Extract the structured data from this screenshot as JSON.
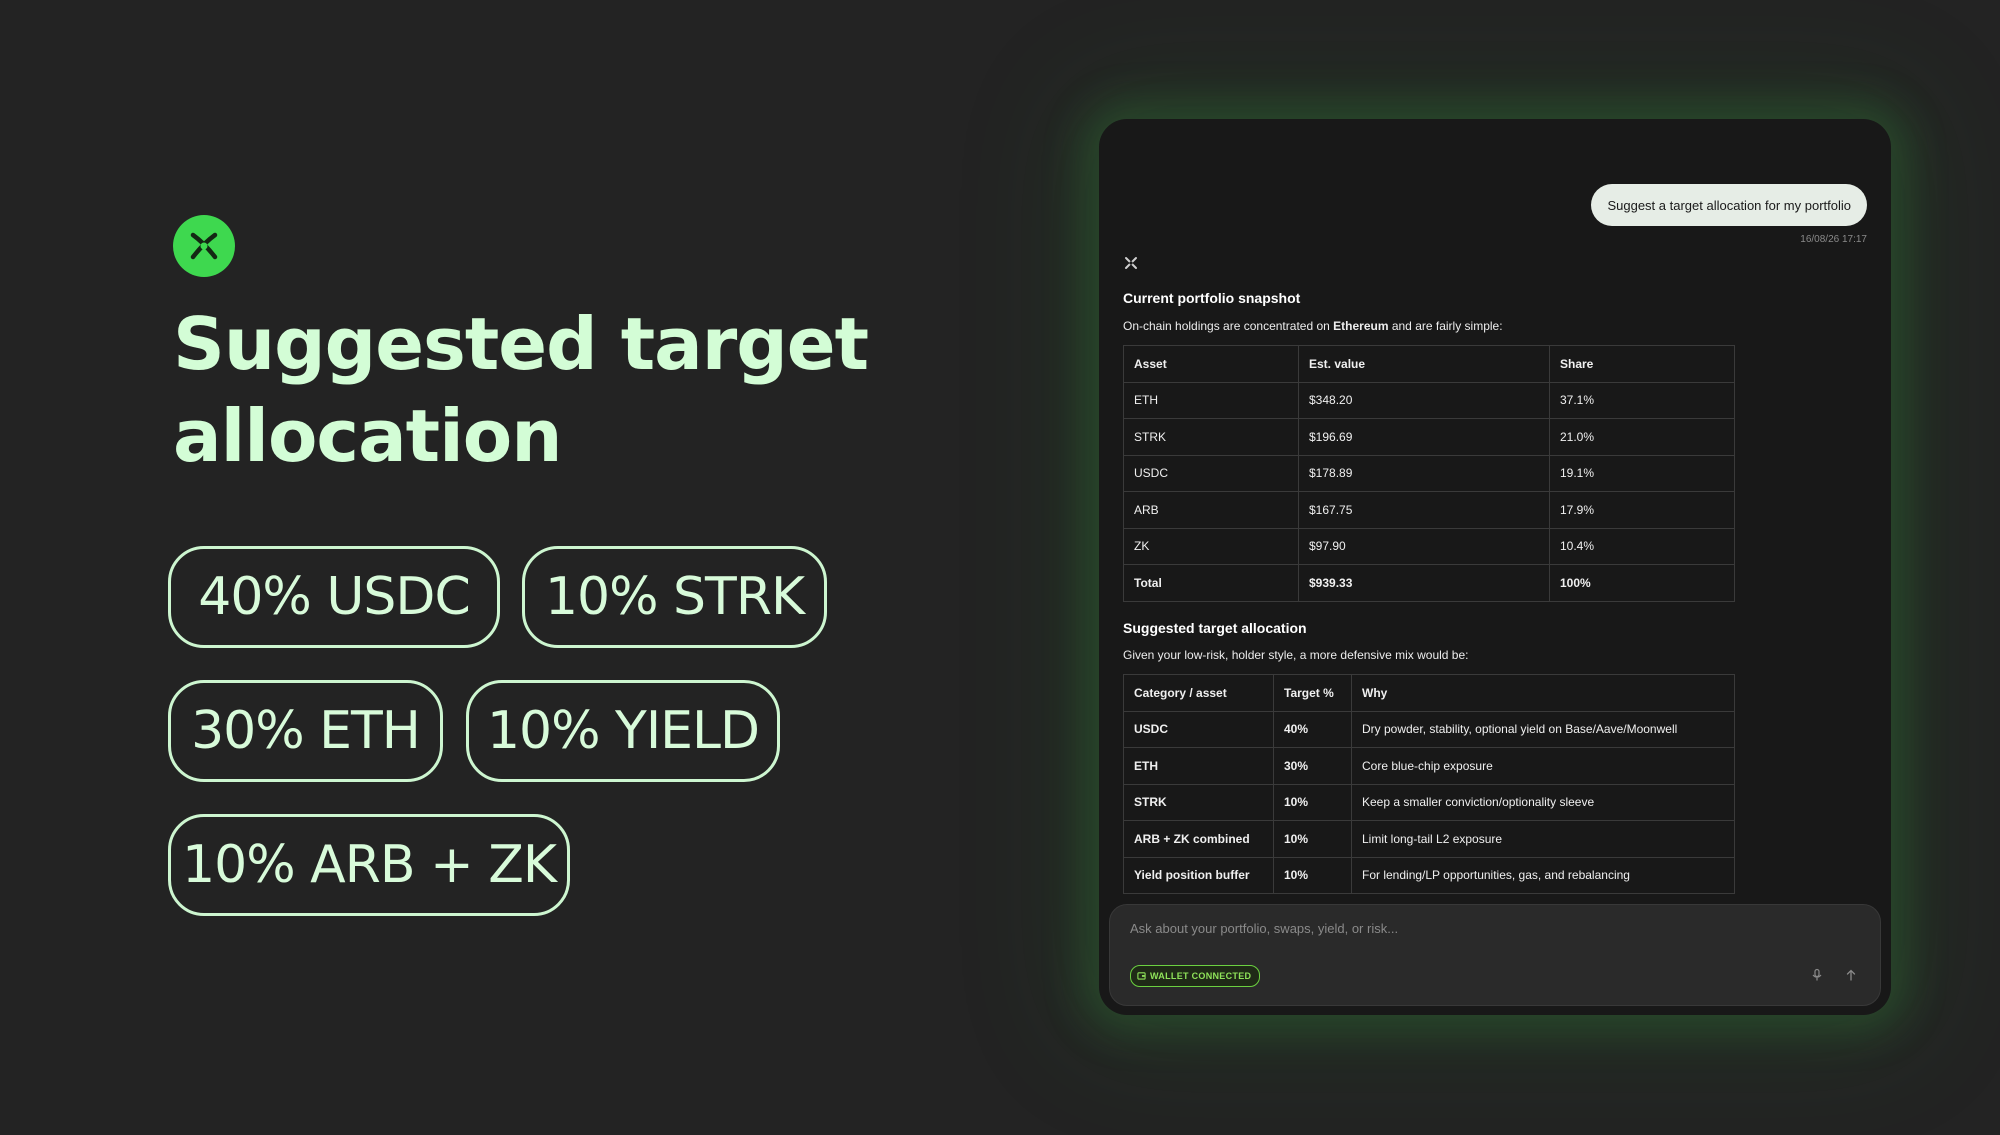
{
  "hero": {
    "title": "Suggested target allocation",
    "pills": [
      {
        "label": "40% USDC"
      },
      {
        "label": "10% STRK"
      },
      {
        "label": "30% ETH"
      },
      {
        "label": "10% YIELD"
      },
      {
        "label": "10% ARB + ZK"
      }
    ]
  },
  "chat": {
    "user_message": "Suggest a target allocation for my portfolio",
    "timestamp": "16/08/26 17:17",
    "snapshot": {
      "title": "Current portfolio snapshot",
      "intro_before": "On-chain holdings are concentrated on ",
      "intro_bold": "Ethereum",
      "intro_after": " and are fairly simple:",
      "headers": [
        "Asset",
        "Est. value",
        "Share"
      ],
      "rows": [
        [
          "ETH",
          "$348.20",
          "37.1%"
        ],
        [
          "STRK",
          "$196.69",
          "21.0%"
        ],
        [
          "USDC",
          "$178.89",
          "19.1%"
        ],
        [
          "ARB",
          "$167.75",
          "17.9%"
        ],
        [
          "ZK",
          "$97.90",
          "10.4%"
        ],
        [
          "Total",
          "$939.33",
          "100%"
        ]
      ]
    },
    "allocation": {
      "title": "Suggested target allocation",
      "intro": "Given your low-risk, holder style, a more defensive mix would be:",
      "headers": [
        "Category / asset",
        "Target %",
        "Why"
      ],
      "rows": [
        [
          "USDC",
          "40%",
          "Dry powder, stability, optional yield on Base/Aave/Moonwell"
        ],
        [
          "ETH",
          "30%",
          "Core blue-chip exposure"
        ],
        [
          "STRK",
          "10%",
          "Keep a smaller conviction/optionality sleeve"
        ],
        [
          "ARB + ZK combined",
          "10%",
          "Limit long-tail L2 exposure"
        ],
        [
          "Yield position buffer",
          "10%",
          "For lending/LP opportunities, gas, and rebalancing"
        ]
      ]
    },
    "input": {
      "placeholder": "Ask about your portfolio, swaps, yield, or risk...",
      "wallet_badge": "WALLET CONNECTED"
    }
  },
  "colors": {
    "background": "#232323",
    "accent_green": "#3ed84f",
    "hero_text": "#d3fdd6",
    "panel": "#181818"
  },
  "icons": [
    "logo-icon",
    "bot-icon",
    "wallet-icon",
    "mic-icon",
    "send-arrow-icon"
  ]
}
